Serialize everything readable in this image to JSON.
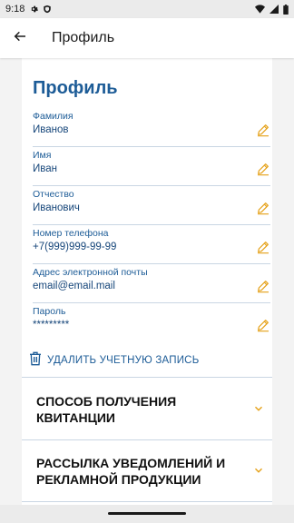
{
  "status_bar": {
    "time": "9:18",
    "icons": [
      "gear-icon",
      "shield-icon",
      "wifi-icon",
      "signal-icon",
      "battery-icon"
    ]
  },
  "app_bar": {
    "title": "Профиль",
    "back_icon": "arrow-left-icon"
  },
  "profile": {
    "heading": "Профиль",
    "fields": [
      {
        "label": "Фамилия",
        "value": "Иванов"
      },
      {
        "label": "Имя",
        "value": "Иван"
      },
      {
        "label": "Отчество",
        "value": "Иванович"
      },
      {
        "label": "Номер телефона",
        "value": "+7(999)999-99-99"
      },
      {
        "label": "Адрес электронной почты",
        "value": "email@email.mail"
      },
      {
        "label": "Пароль",
        "value": "*********"
      }
    ],
    "edit_icon": "pencil-icon",
    "delete_account_label": "УДАЛИТЬ УЧЕТНУЮ ЗАПИСЬ",
    "delete_icon": "trash-icon"
  },
  "accordions": [
    {
      "title": "СПОСОБ ПОЛУЧЕНИЯ КВИТАНЦИИ",
      "icon": "chevron-down-icon"
    },
    {
      "title": "РАССЫЛКА УВЕДОМЛЕНИЙ И РЕКЛАМНОЙ ПРОДУКЦИИ",
      "icon": "chevron-down-icon"
    }
  ],
  "colors": {
    "primary_blue": "#1d5c97",
    "value_blue": "#16467a",
    "accent_orange": "#e5a118",
    "divider": "#c9d6e3",
    "background_gray": "#f3f3f3"
  }
}
